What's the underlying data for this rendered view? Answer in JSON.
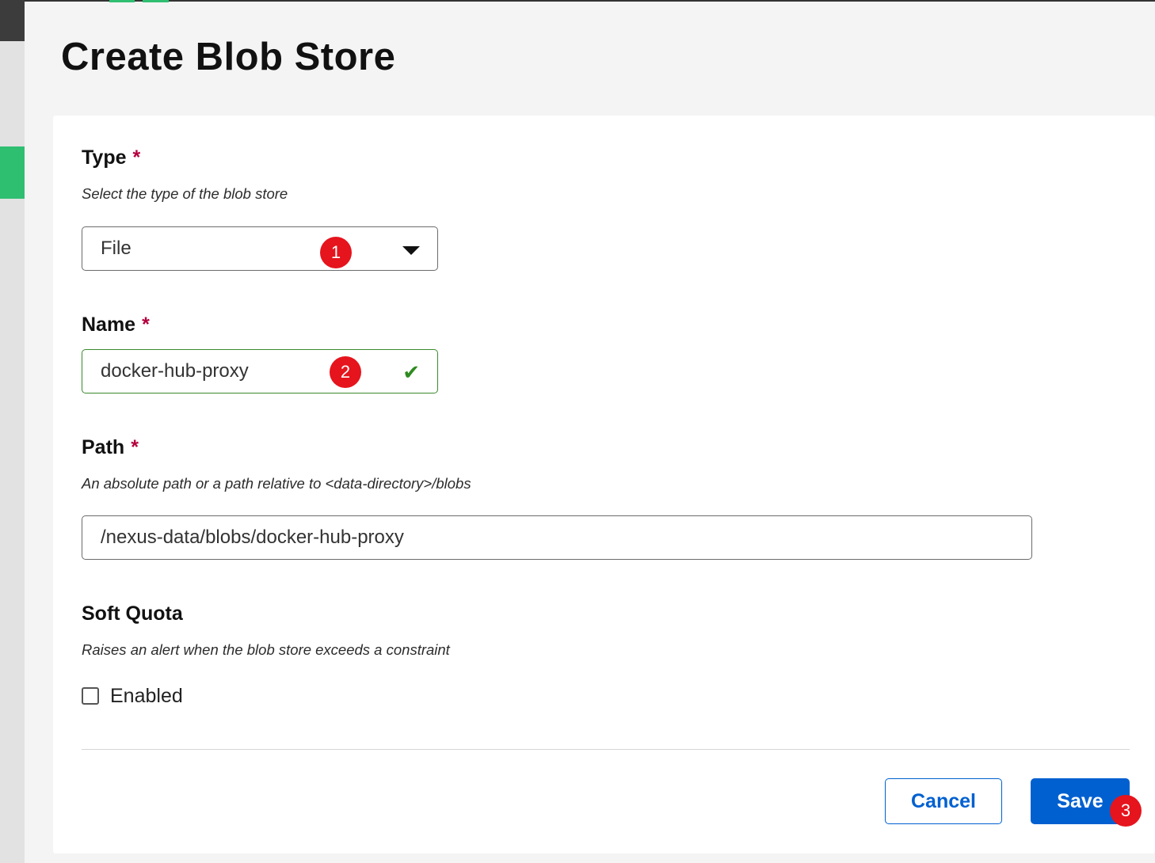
{
  "page": {
    "title": "Create Blob Store"
  },
  "form": {
    "type": {
      "label": "Type",
      "required_mark": "*",
      "description": "Select the type of the blob store",
      "selected_value": "File"
    },
    "name": {
      "label": "Name",
      "required_mark": "*",
      "value": "docker-hub-proxy"
    },
    "path": {
      "label": "Path",
      "required_mark": "*",
      "description": "An absolute path or a path relative to <data-directory>/blobs",
      "value": "/nexus-data/blobs/docker-hub-proxy"
    },
    "soft_quota": {
      "label": "Soft Quota",
      "description": "Raises an alert when the blob store exceeds a constraint",
      "checkbox_label": "Enabled",
      "checked": false
    }
  },
  "actions": {
    "cancel_label": "Cancel",
    "save_label": "Save"
  },
  "annotations": {
    "badge1": "1",
    "badge2": "2",
    "badge3": "3"
  },
  "colors": {
    "primary": "#0060d0",
    "required": "#b3003d",
    "valid": "#2f8a1f",
    "badge": "#e5141d",
    "nav_active": "#2fbf71"
  }
}
